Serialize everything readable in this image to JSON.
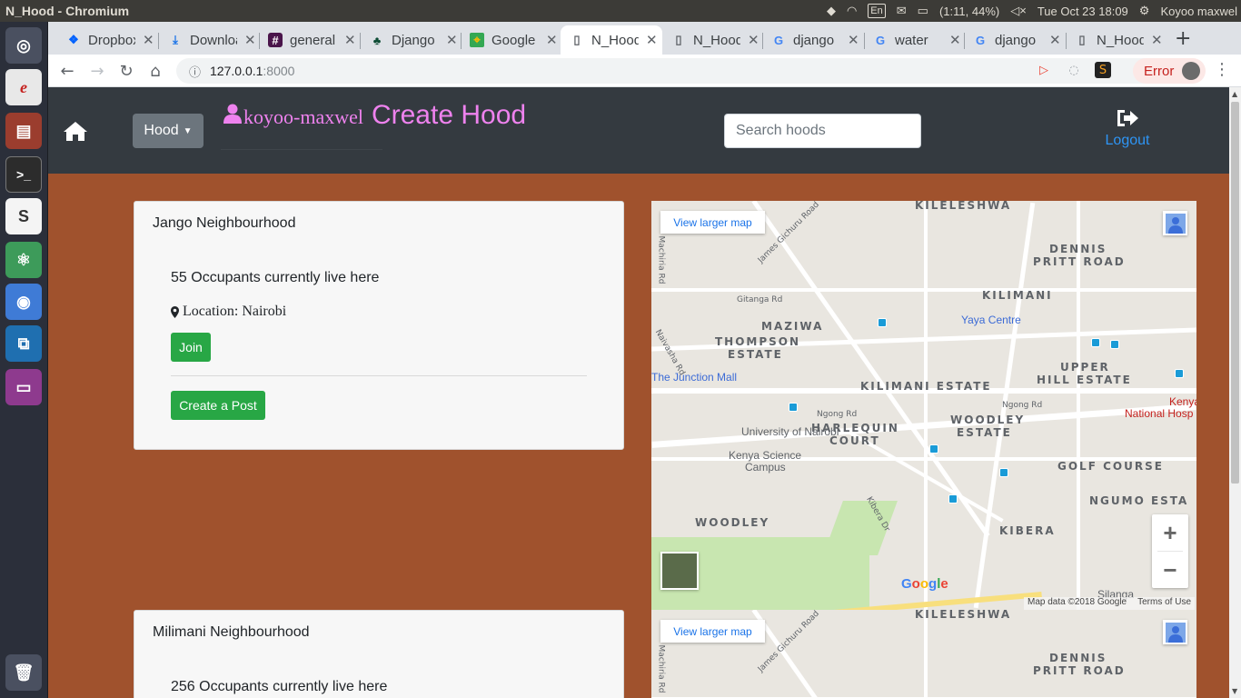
{
  "os": {
    "window_title": "N_Hood - Chromium",
    "indicators": {
      "keyboard": "En",
      "battery": "(1:11, 44%)",
      "clock": "Tue Oct 23 18:09",
      "user": "Koyoo maxwel"
    }
  },
  "browser": {
    "tabs": [
      {
        "label": "Dropbox",
        "icon": "dropbox-icon",
        "active": false
      },
      {
        "label": "Downloads",
        "icon": "download-icon",
        "active": false
      },
      {
        "label": "general",
        "icon": "slack-hash-icon",
        "active": false
      },
      {
        "label": "Django",
        "icon": "django-icon",
        "active": false
      },
      {
        "label": "Google Maps",
        "icon": "google-maps-icon",
        "active": false
      },
      {
        "label": "N_Hood",
        "icon": "page-icon",
        "active": true
      },
      {
        "label": "N_Hood",
        "icon": "page-icon",
        "active": false
      },
      {
        "label": "django",
        "icon": "google-icon",
        "active": false
      },
      {
        "label": "water",
        "icon": "google-icon",
        "active": false
      },
      {
        "label": "django",
        "icon": "google-icon",
        "active": false
      },
      {
        "label": "N_Hood",
        "icon": "page-icon",
        "active": false
      }
    ],
    "url_host": "127.0.0.1",
    "url_port": ":8000",
    "error_label": "Error"
  },
  "navbar": {
    "dropdown_label": "Hood",
    "username": "koyoo-maxwel",
    "create_label": "Create Hood",
    "search_placeholder": "Search hoods",
    "logout_label": "Logout"
  },
  "hoods": [
    {
      "name": "Jango Neighbourhood",
      "occupants": "55 Occupants currently live here",
      "location": "Location: Nairobi",
      "join_label": "Join",
      "post_label": "Create a Post"
    },
    {
      "name": "Milimani Neighbourhood",
      "occupants": "256 Occupants currently live here"
    }
  ],
  "map": {
    "view_larger": "View larger map",
    "google": "Google",
    "map_data": "Map data ©2018 Google",
    "terms": "Terms of Use",
    "areas": [
      "KILELESHWA",
      "DENNIS",
      "PRITT ROAD",
      "KILIMANI",
      "MAZIWA",
      "THOMPSON",
      "ESTATE",
      "UPPER",
      "HILL ESTATE",
      "KILIMANI ESTATE",
      "HARLEQUIN",
      "COURT",
      "WOODLEY",
      "ESTATE",
      "GOLF COURSE",
      "NGUMO ESTA",
      "WOODLEY",
      "KIBERA"
    ],
    "streets": [
      "James Gichuru Road",
      "Gitanga Rd",
      "Ngong Rd",
      "Ngong Rd",
      "Kibera Dr",
      "Machiria Rd",
      "Naivasha Rd"
    ],
    "pois": [
      "Yaya Centre",
      "The Junction Mall",
      "University of Nairobi",
      "Kenya Science",
      "Campus",
      "Kenya",
      "National Hosp",
      "Silanga"
    ]
  }
}
